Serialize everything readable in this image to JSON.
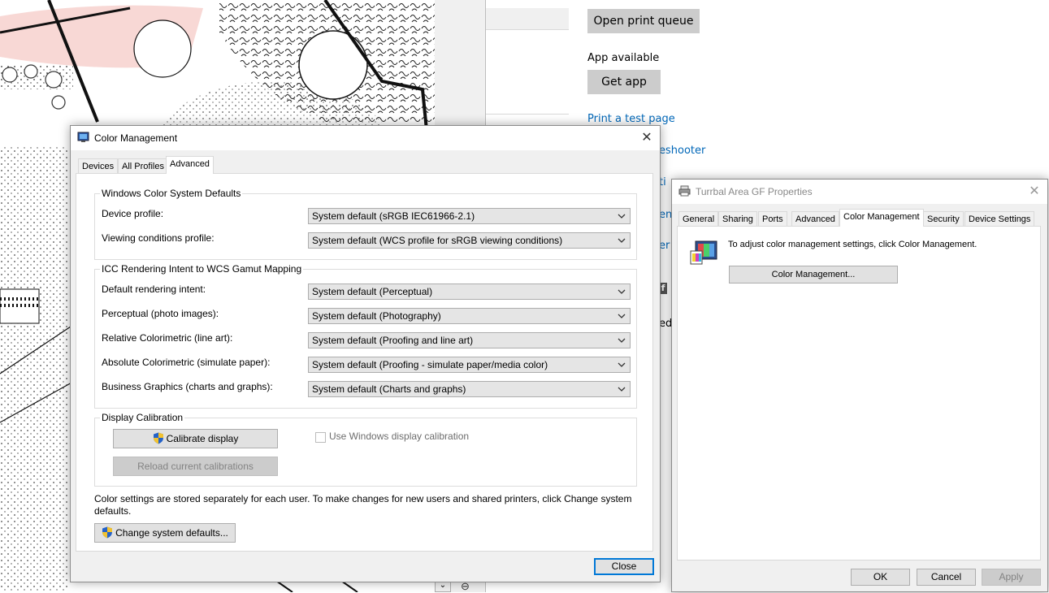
{
  "settings_page": {
    "open_queue_label": "Open print queue",
    "app_available_label": "App available",
    "get_app_label": "Get app",
    "print_test_link": "Print a test page",
    "troubleshooter_link": "eshooter",
    "frag1": "ti",
    "frag2": "en",
    "frag3": "er",
    "frag4": "ed"
  },
  "color_dialog": {
    "title": "Color Management",
    "tabs": [
      "Devices",
      "All Profiles",
      "Advanced"
    ],
    "active_tab": "Advanced",
    "wcs_group": {
      "title": "Windows Color System Defaults",
      "rows": [
        {
          "label": "Device profile:",
          "value": "System default (sRGB IEC61966-2.1)"
        },
        {
          "label": "Viewing conditions profile:",
          "value": "System default (WCS profile for sRGB viewing conditions)"
        }
      ]
    },
    "icc_group": {
      "title": "ICC Rendering Intent to WCS Gamut Mapping",
      "rows": [
        {
          "label": "Default rendering intent:",
          "value": "System default (Perceptual)"
        },
        {
          "label": "Perceptual (photo images):",
          "value": "System default (Photography)"
        },
        {
          "label": "Relative Colorimetric (line art):",
          "value": "System default (Proofing and line art)"
        },
        {
          "label": "Absolute Colorimetric (simulate paper):",
          "value": "System default (Proofing - simulate paper/media color)"
        },
        {
          "label": "Business Graphics (charts and graphs):",
          "value": "System default (Charts and graphs)"
        }
      ]
    },
    "calibration_group": {
      "title": "Display Calibration",
      "calibrate_label": "Calibrate display",
      "reload_label": "Reload current calibrations",
      "use_windows_label": "Use Windows display calibration"
    },
    "note": "Color settings are stored separately for each user. To make changes for new users and shared printers, click Change system defaults.",
    "change_defaults_label": "Change system defaults...",
    "close_label": "Close"
  },
  "props_dialog": {
    "title": "Turrbal Area GF Properties",
    "tabs": [
      "General",
      "Sharing",
      "Ports",
      "Advanced",
      "Color Management",
      "Security",
      "Device Settings"
    ],
    "active_tab": "Color Management",
    "instruction": "To adjust color management settings, click Color Management.",
    "color_mgmt_button": "Color Management...",
    "ok_label": "OK",
    "cancel_label": "Cancel",
    "apply_label": "Apply"
  },
  "colors": {
    "link": "#0067b8",
    "focus": "#0078d7"
  }
}
